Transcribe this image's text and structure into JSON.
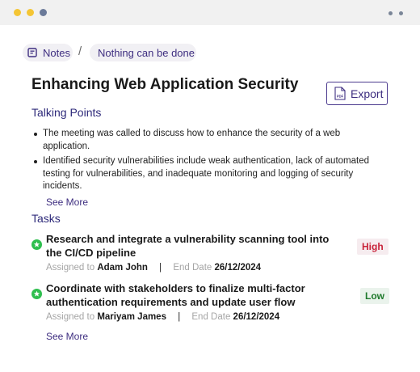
{
  "colors": {
    "titlebar_bg": "#f1f1f1",
    "dot_1": "#f4c534",
    "dot_2": "#f4c534",
    "dot_3": "#6b7a99",
    "accent": "#3e2e80",
    "check_green": "#2fbf4f",
    "high": "#c8233a",
    "low": "#1f7a2c"
  },
  "breadcrumb": {
    "notes_label": "Notes",
    "notes_icon": "note-icon",
    "separator": "/",
    "current": "Nothing can be done"
  },
  "page_title": "Enhancing Web Application Security",
  "export": {
    "label": "Export",
    "icon": "pdf-icon",
    "icon_text": "PDF"
  },
  "talking_points": {
    "heading": "Talking Points",
    "items": [
      "The meeting was called to discuss how to enhance the security of a web application.",
      "Identified security vulnerabilities include weak authentication, lack of automated testing for vulnerabilities, and inadequate monitoring and logging of security incidents."
    ],
    "see_more": "See More"
  },
  "tasks": {
    "heading": "Tasks",
    "items": [
      {
        "status_icon": "check-badge-icon",
        "title": "Research and integrate a vulnerability scanning tool into the CI/CD pipeline",
        "priority": "High",
        "assigned_label": "Assigned to",
        "assignee": "Adam John",
        "separator": "|",
        "end_date_label": "End Date",
        "end_date": "26/12/2024"
      },
      {
        "status_icon": "check-badge-icon",
        "title": "Coordinate with stakeholders to finalize multi-factor authentication requirements and update user flow",
        "priority": "Low",
        "assigned_label": "Assigned to",
        "assignee": "Mariyam James",
        "separator": "|",
        "end_date_label": "End Date",
        "end_date": "26/12/2024"
      }
    ],
    "see_more": "See More"
  }
}
